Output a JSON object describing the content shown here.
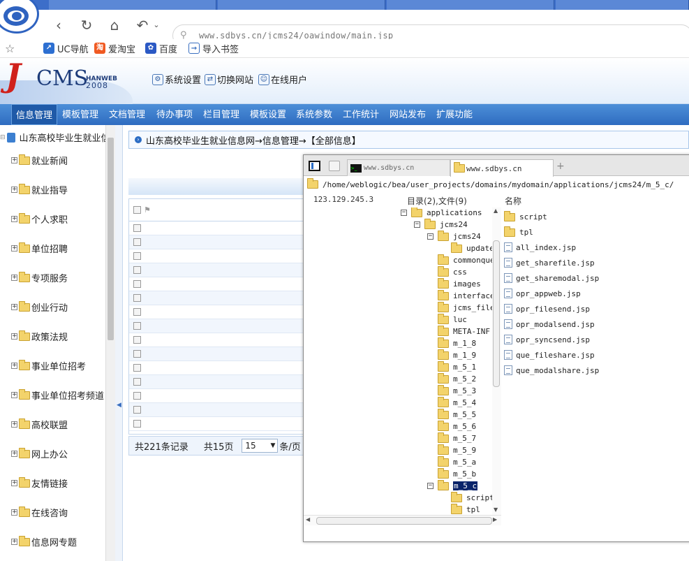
{
  "browser": {
    "url": "www.sdbys.cn/jcms24/oawindow/main.jsp",
    "bookmarks": [
      "UC导航",
      "爱淘宝",
      "百度",
      "导入书签"
    ]
  },
  "cms": {
    "logo": {
      "letter": "J",
      "name": "CMS",
      "brand": "HANWEB",
      "year": "2008"
    },
    "header_links": [
      "系统设置",
      "切换网站",
      "在线用户"
    ],
    "menu": [
      "信息管理",
      "模板管理",
      "文档管理",
      "待办事项",
      "栏目管理",
      "模板设置",
      "系统参数",
      "工作统计",
      "网站发布",
      "扩展功能"
    ],
    "sidebar": {
      "root": "山东高校毕业生就业信",
      "items": [
        "就业新闻",
        "就业指导",
        "个人求职",
        "单位招聘",
        "专项服务",
        "创业行动",
        "政策法规",
        "事业单位招考",
        "事业单位招考频道",
        "高校联盟",
        "网上办公",
        "友情链接",
        "在线咨询",
        "信息网专题"
      ]
    },
    "breadcrumb": "山东高校毕业生就业信息网→信息管理→【全部信息】",
    "pager": {
      "total": "共221条记录",
      "pages": "共15页",
      "page_size": "15",
      "unit": "条/页"
    }
  },
  "file_manager": {
    "tabs": [
      "www.sdbys.cn",
      "www.sdbys.cn"
    ],
    "path": "/home/weblogic/bea/user_projects/domains/mydomain/applications/jcms24/m_5_c/",
    "ip": "123.129.245.3",
    "counts": "目录(2),文件(9)",
    "name_header": "名称",
    "tree": [
      "applications",
      "jcms24",
      "jcms24",
      "update",
      "commonquery",
      "css",
      "images",
      "interface",
      "jcms_files",
      "luc",
      "META-INF",
      "m_1_8",
      "m_1_9",
      "m_5_1",
      "m_5_2",
      "m_5_3",
      "m_5_4",
      "m_5_5",
      "m_5_6",
      "m_5_7",
      "m_5_9",
      "m_5_a",
      "m_5_b",
      "m_5_c",
      "script",
      "tpl"
    ],
    "folders": [
      "script",
      "tpl"
    ],
    "files": [
      "all_index.jsp",
      "get_sharefile.jsp",
      "get_sharemodal.jsp",
      "opr_appweb.jsp",
      "opr_filesend.jsp",
      "opr_modalsend.jsp",
      "opr_syncsend.jsp",
      "que_fileshare.jsp",
      "que_modalshare.jsp"
    ]
  },
  "colors": {
    "menu_bg": "#2f6cc0",
    "logo_red": "#d0211b",
    "selection": "#0a246a"
  }
}
